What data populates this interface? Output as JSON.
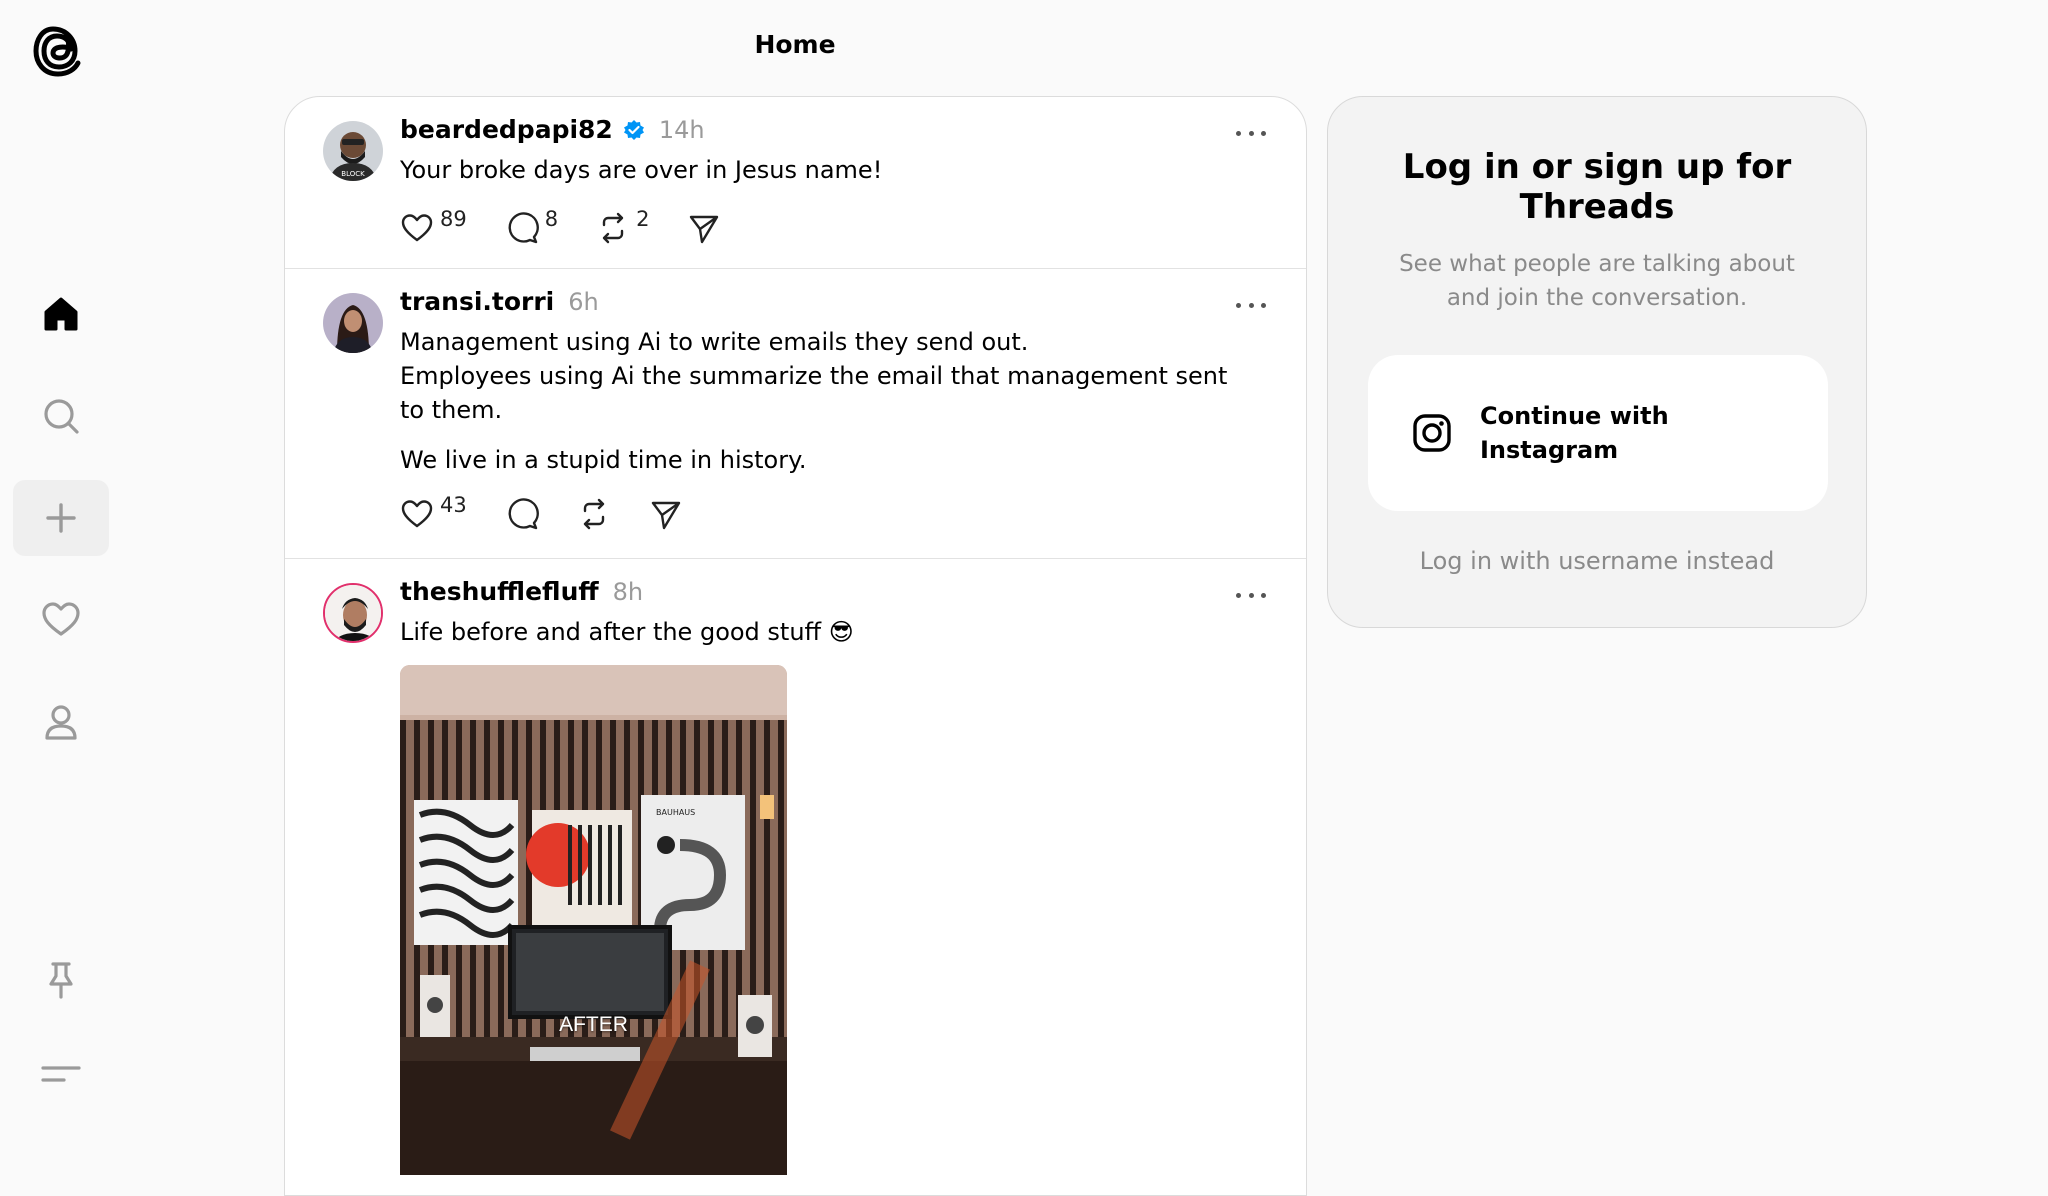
{
  "header": {
    "title": "Home"
  },
  "sidebar": {
    "logo": "threads-logo-icon",
    "items": [
      {
        "name": "home",
        "icon": "home-icon"
      },
      {
        "name": "search",
        "icon": "search-icon"
      },
      {
        "name": "create",
        "icon": "plus-icon"
      },
      {
        "name": "activity",
        "icon": "heart-icon"
      },
      {
        "name": "profile",
        "icon": "person-icon"
      },
      {
        "name": "pinned",
        "icon": "pin-icon"
      },
      {
        "name": "menu",
        "icon": "menu-icon"
      }
    ]
  },
  "posts": [
    {
      "username": "beardedpapi82",
      "verified": true,
      "time": "14h",
      "text": "Your broke days are over in Jesus name!",
      "likes": "89",
      "replies": "8",
      "reposts": "2"
    },
    {
      "username": "transi.torri",
      "verified": false,
      "time": "6h",
      "text_lines": [
        "Management using Ai to write emails they send out.",
        "Employees using Ai the summarize the email that management sent to them."
      ],
      "text_extra": "We live in a stupid time in history.",
      "likes": "43",
      "replies": "",
      "reposts": ""
    },
    {
      "username": "theshufflefluff",
      "verified": false,
      "time": "8h",
      "text": "Life before and after the good stuff 😎",
      "image_label": "AFTER",
      "image_poster_text": "BAUHAUS"
    }
  ],
  "login": {
    "title": "Log in or sign up for Threads",
    "subtitle": "See what people are talking about and join the conversation.",
    "instagram_button": "Continue with Instagram",
    "username_link": "Log in with username instead"
  },
  "colors": {
    "background": "#fafafa",
    "verified": "#0095f6",
    "muted": "#8a8a8a"
  }
}
